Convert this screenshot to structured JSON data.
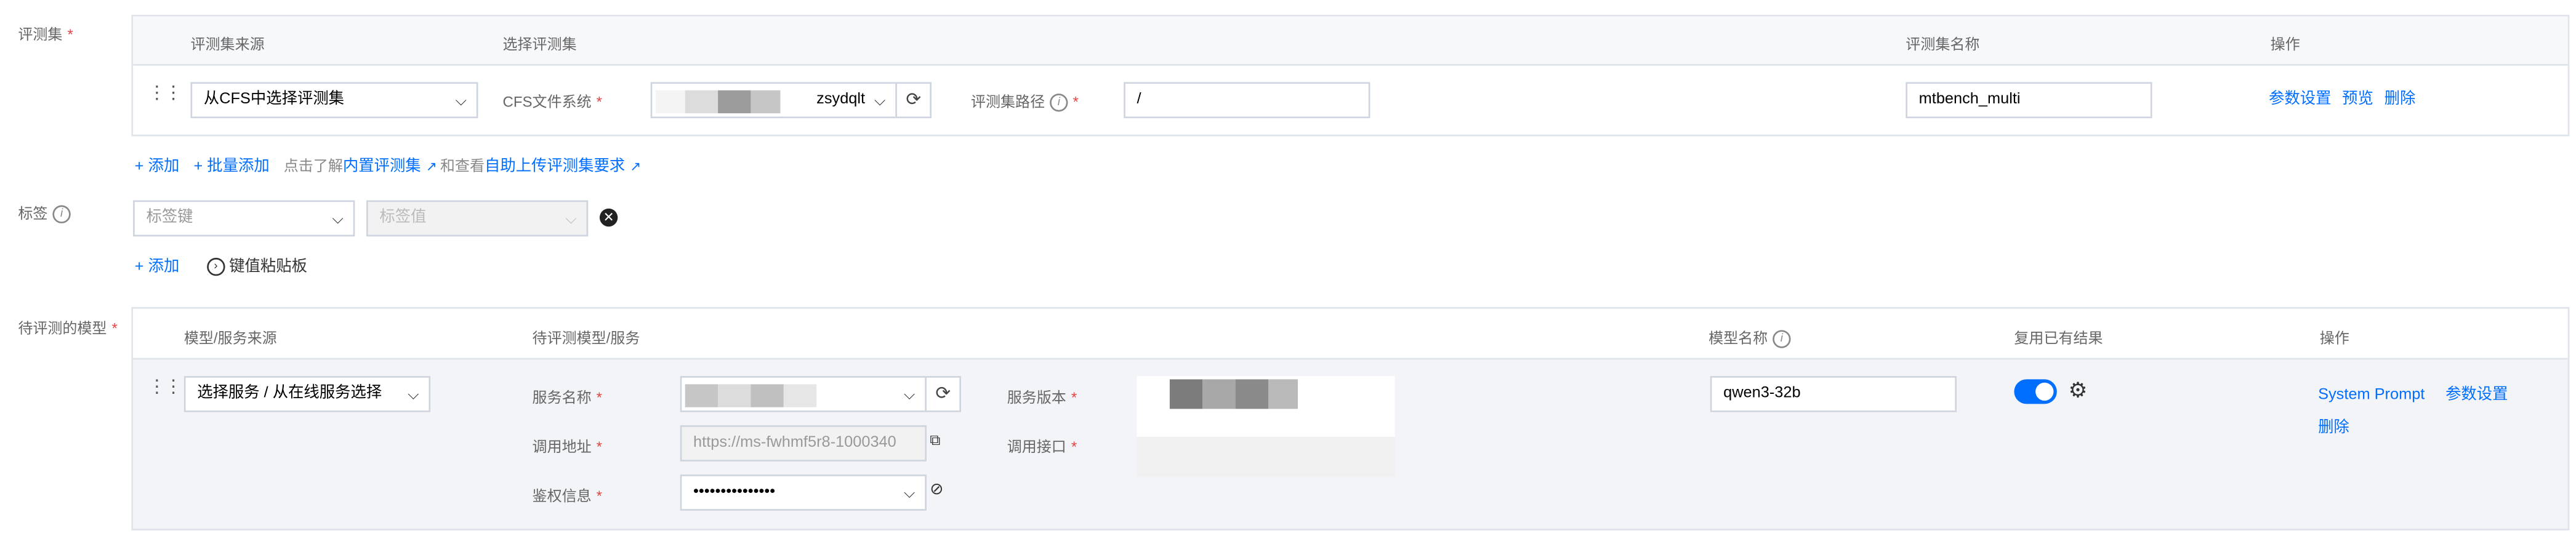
{
  "section1": {
    "label": "评测集",
    "table": {
      "headers": {
        "source": "评测集来源",
        "select": "选择评测集",
        "name": "评测集名称",
        "ops": "操作"
      },
      "row": {
        "source_value": "从CFS中选择评测集",
        "cfs_label": "CFS文件系统",
        "cfs_value": "zsydqlt",
        "path_label": "评测集路径",
        "path_value": "/",
        "name_value": "mtbench_multi",
        "ops": {
          "params": "参数设置",
          "preview": "预览",
          "delete": "删除"
        }
      }
    },
    "actions": {
      "add": "添加",
      "batch_add": "批量添加",
      "hint_prefix": "点击了解",
      "builtin_link": "内置评测集",
      "hint_mid": "和查看",
      "upload_link": "自助上传评测集要求"
    }
  },
  "tags": {
    "label": "标签",
    "key_placeholder": "标签键",
    "value_placeholder": "标签值",
    "add": "添加",
    "paste": "键值粘贴板"
  },
  "models": {
    "label": "待评测的模型",
    "headers": {
      "source": "模型/服务来源",
      "service": "待评测模型/服务",
      "name": "模型名称",
      "reuse": "复用已有结果",
      "ops": "操作"
    },
    "row": {
      "source_value": "选择服务 / 从在线服务选择",
      "service_name_label": "服务名称",
      "service_version_label": "服务版本",
      "url_label": "调用地址",
      "url_value": "https://ms-fwhmf5r8-1000340",
      "endpoint_label": "调用接口",
      "auth_label": "鉴权信息",
      "auth_value": "•••••••••••••••",
      "model_name_value": "qwen3-32b",
      "reuse_enabled": true,
      "ops": {
        "system_prompt": "System Prompt",
        "params": "参数设置",
        "delete": "删除"
      }
    }
  },
  "colors": {
    "accent": "#006eff",
    "required": "#e54545",
    "border": "#dfe3ea"
  }
}
